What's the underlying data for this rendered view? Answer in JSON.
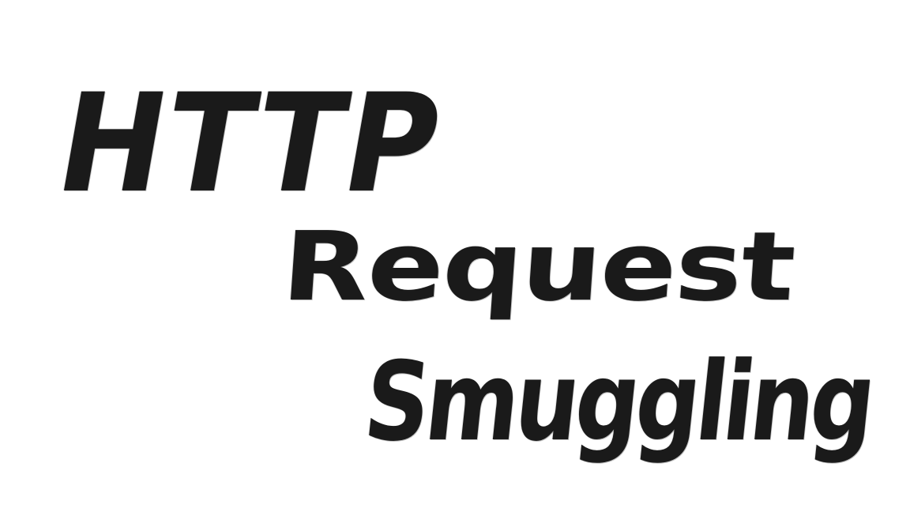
{
  "drawing": {
    "lines": [
      "HTTP",
      "Request",
      "Smuggling"
    ],
    "ink_color": "#1a1a1a",
    "background_color": "#ffffff"
  }
}
